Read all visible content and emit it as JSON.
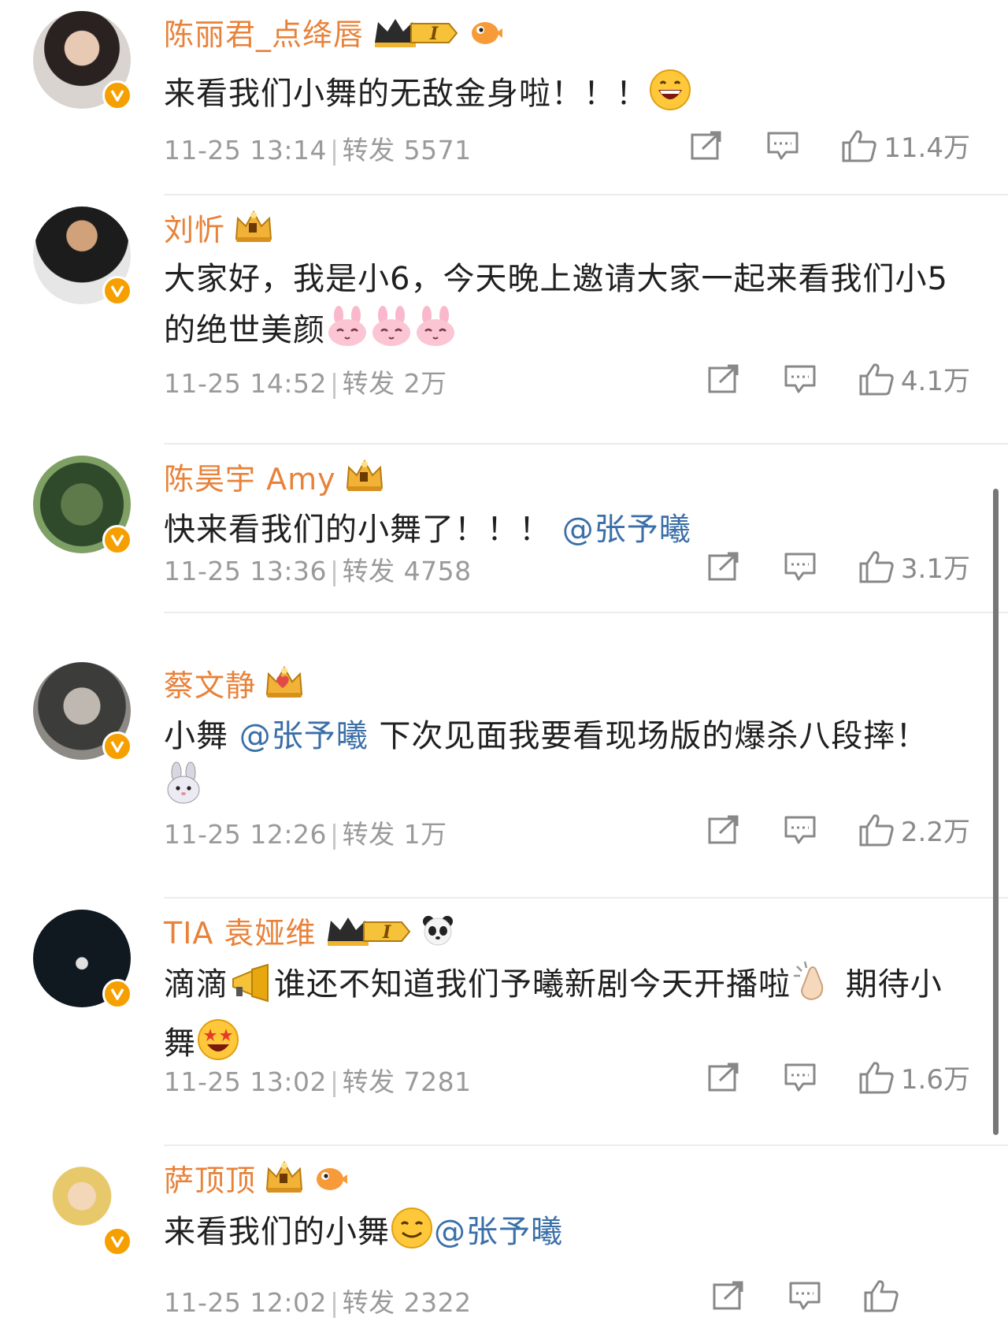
{
  "posts": [
    {
      "name": "陈丽君_点绛唇",
      "badges": [
        "crown-vip-1-badge",
        "pufferfish-badge"
      ],
      "text": [
        {
          "t": "来看我们小舞的无敌金身啦！！！"
        },
        {
          "emoji": "grinning-emoji"
        }
      ],
      "time": "11-25 13:14",
      "repost_label": "转发",
      "repost_count": "5571",
      "likes": "11.4万"
    },
    {
      "name": "刘忻",
      "badges": [
        "crown-badge"
      ],
      "text": [
        {
          "t": "大家好，我是小6，今天晚上邀请大家一起来看我们小5的绝世美颜"
        },
        {
          "emoji": "bunny-face-emoji"
        },
        {
          "emoji": "bunny-face-emoji"
        },
        {
          "emoji": "bunny-face-emoji"
        }
      ],
      "time": "11-25 14:52",
      "repost_label": "转发",
      "repost_count": "2万",
      "likes": "4.1万"
    },
    {
      "name": "陈昊宇 Amy",
      "badges": [
        "crown-badge"
      ],
      "text": [
        {
          "t": "快来看我们的小舞了！！！ "
        },
        {
          "m": "@张予曦"
        }
      ],
      "time": "11-25 13:36",
      "repost_label": "转发",
      "repost_count": "4758",
      "likes": "3.1万"
    },
    {
      "name": "蔡文静",
      "badges": [
        "heart-crown-badge"
      ],
      "text": [
        {
          "t": "小舞 "
        },
        {
          "m": "@张予曦"
        },
        {
          "t": " 下次见面我要看现场版的爆杀八段摔！ "
        },
        {
          "emoji": "rabbit-emoji"
        }
      ],
      "time": "11-25 12:26",
      "repost_label": "转发",
      "repost_count": "1万",
      "likes": "2.2万"
    },
    {
      "name": "TIA 袁娅维",
      "badges": [
        "crown-vip-1-badge",
        "panda-badge"
      ],
      "text": [
        {
          "t": "滴滴"
        },
        {
          "emoji": "megaphone-emoji"
        },
        {
          "t": "谁还不知道我们予曦新剧今天开播啦"
        },
        {
          "emoji": "clapping-emoji"
        },
        {
          "t": " 期待小舞"
        },
        {
          "emoji": "star-struck-emoji"
        }
      ],
      "time": "11-25 13:02",
      "repost_label": "转发",
      "repost_count": "7281",
      "likes": "1.6万"
    },
    {
      "name": "萨顶顶",
      "badges": [
        "crown-badge",
        "pufferfish-badge"
      ],
      "text": [
        {
          "t": "来看我们的小舞"
        },
        {
          "emoji": "smiling-emoji"
        },
        {
          "m": "@张予曦"
        }
      ],
      "time": "11-25 12:02",
      "repost_label": "转发",
      "repost_count": "2322",
      "likes": ""
    }
  ],
  "colors": {
    "name": "#e8823a",
    "mention": "#3b6fa8",
    "meta": "#9a9a9a",
    "verified": "#f5a000"
  }
}
